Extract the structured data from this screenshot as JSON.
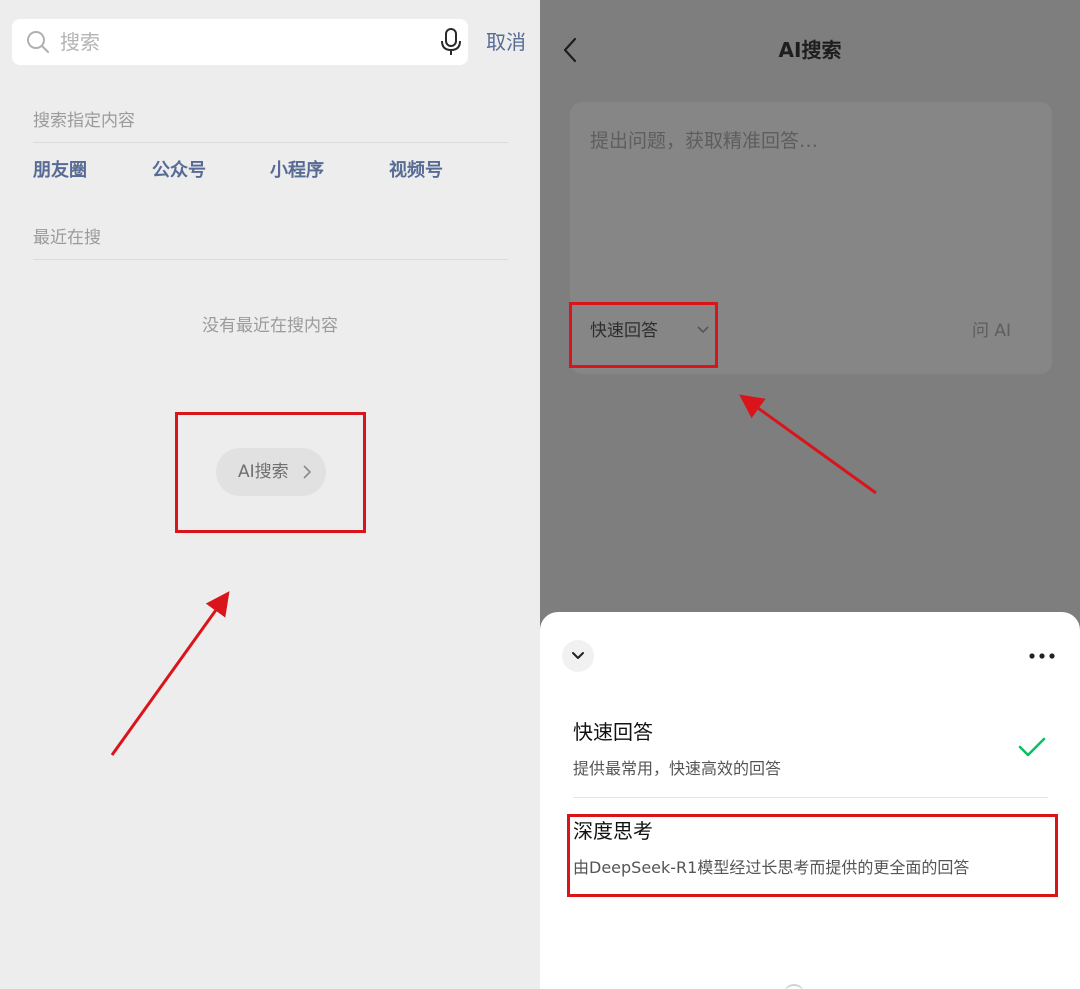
{
  "left": {
    "search": {
      "placeholder": "搜索",
      "cancel_label": "取消"
    },
    "specified_section": {
      "label": "搜索指定内容",
      "items": [
        "朋友圈",
        "公众号",
        "小程序",
        "视频号"
      ]
    },
    "recent_section": {
      "label": "最近在搜",
      "empty_text": "没有最近在搜内容"
    },
    "ai_button_label": "AI搜索"
  },
  "right": {
    "title": "AI搜索",
    "question": {
      "placeholder": "提出问题，获取精准回答…"
    },
    "mode_selector": {
      "current": "快速回答"
    },
    "ask_label": "问 AI",
    "sheet": {
      "options": [
        {
          "title": "快速回答",
          "description": "提供最常用，快速高效的回答",
          "selected": true
        },
        {
          "title": "深度思考",
          "description": "由DeepSeek-R1模型经过长思考而提供的更全面的回答",
          "selected": false
        }
      ]
    }
  },
  "colors": {
    "link_blue": "#576b95",
    "annotation_red": "#d9141a",
    "check_green": "#07c160",
    "dim_overlay": "#7e7e7e"
  }
}
